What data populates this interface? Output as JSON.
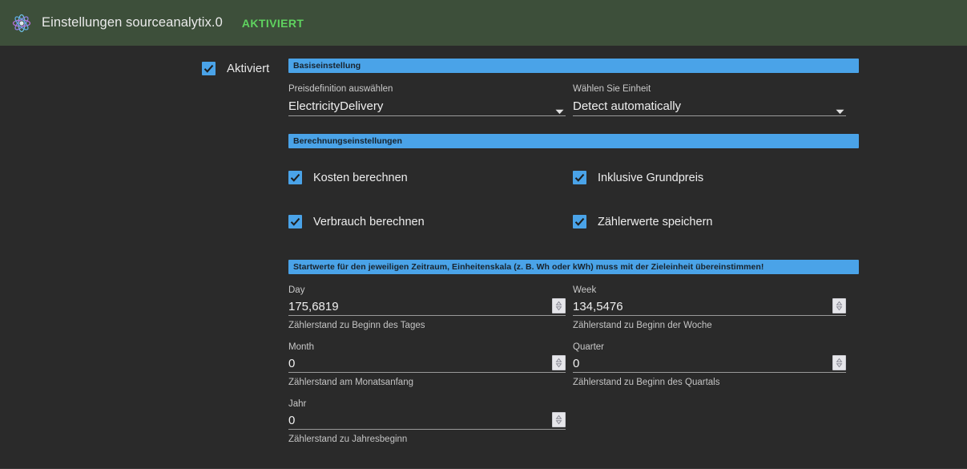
{
  "header": {
    "logo_icon": "atom-icon",
    "title": "Einstellungen sourceanalytix.0",
    "status": "AKTIVIERT",
    "status_color": "#5fd35f",
    "background_color": "#3d4f3a"
  },
  "theme": {
    "page_background": "#2a2a2a",
    "accent": "#4aa3e8",
    "text": "#e8e8e8"
  },
  "enabled": {
    "label": "Aktiviert",
    "checked": true
  },
  "sections": [
    {
      "banner": "Basiseinstellung",
      "fields": [
        {
          "label": "Preisdefinition auswählen",
          "value": "ElectricityDelivery",
          "icon": "chevron-down-icon"
        },
        {
          "label": "Wählen Sie Einheit",
          "value": "Detect automatically",
          "icon": "chevron-down-icon"
        }
      ]
    },
    {
      "banner": "Berechnungseinstellungen",
      "checkboxes": [
        {
          "label": "Kosten berechnen",
          "checked": true
        },
        {
          "label": "Inklusive Grundpreis",
          "checked": true
        },
        {
          "label": "Verbrauch berechnen",
          "checked": true
        },
        {
          "label": "Zählerwerte speichern",
          "checked": true
        }
      ]
    },
    {
      "banner": "Startwerte für den jeweiligen Zeitraum, Einheitenskala (z. B. Wh oder kWh) muss mit der Zieleinheit übereinstimmen!",
      "numbers": [
        {
          "label": "Day",
          "value": "175,6819",
          "help": "Zählerstand zu Beginn des Tages",
          "icon": "spinner-icon"
        },
        {
          "label": "Week",
          "value": "134,5476",
          "help": "Zählerstand zu Beginn der Woche",
          "icon": "spinner-icon"
        },
        {
          "label": "Month",
          "value": "0",
          "help": "Zählerstand am Monatsanfang",
          "icon": "spinner-icon"
        },
        {
          "label": "Quarter",
          "value": "0",
          "help": "Zählerstand zu Beginn des Quartals",
          "icon": "spinner-icon"
        },
        {
          "label": "Jahr",
          "value": "0",
          "help": "Zählerstand zu Jahresbeginn",
          "icon": "spinner-icon"
        }
      ]
    }
  ]
}
